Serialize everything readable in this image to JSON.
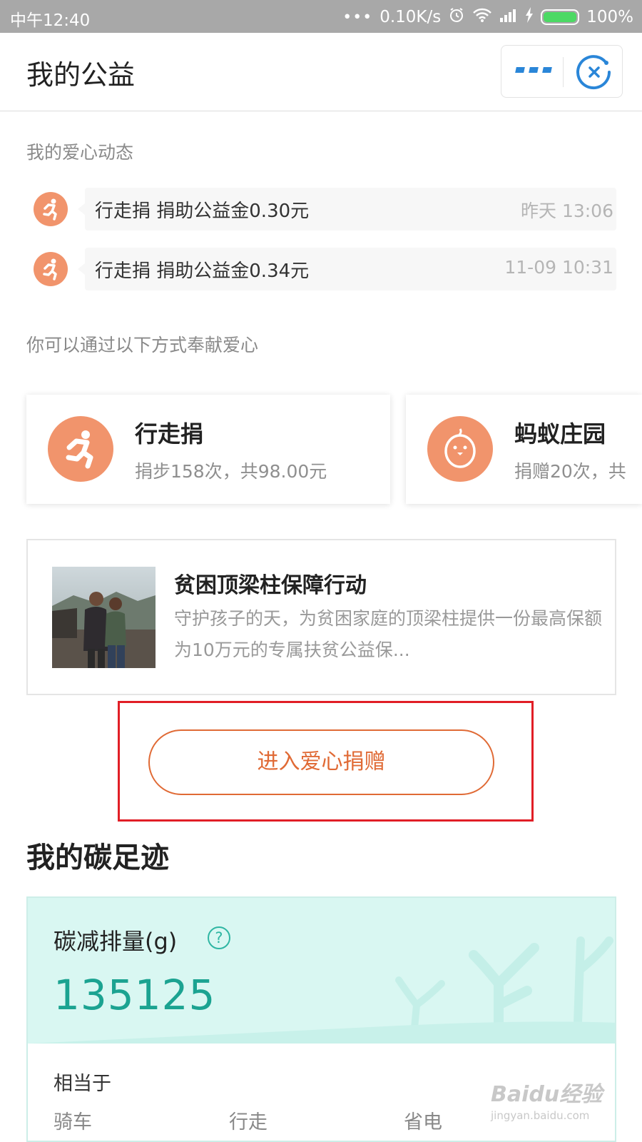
{
  "status_bar": {
    "time": "中午12:40",
    "dots": "•••",
    "network_speed": "0.10K/s",
    "battery": "100%",
    "battery_color": "#4cd964"
  },
  "nav": {
    "title": "我的公益",
    "more_icon": "more-icon",
    "close_icon": "close-icon",
    "accent_color": "#2a86d8"
  },
  "activity": {
    "section_label": "我的爱心动态",
    "items": [
      {
        "text": "行走捐 捐助公益金0.30元",
        "time": "昨天 13:06",
        "icon": "walking-person-icon"
      },
      {
        "text": "行走捐 捐助公益金0.34元",
        "time": "11-09 10:31",
        "icon": "walking-person-icon"
      }
    ]
  },
  "methods": {
    "section_label": "你可以通过以下方式奉献爱心",
    "cards": [
      {
        "title": "行走捐",
        "subtitle": "捐步158次，共98.00元",
        "icon": "running-person-icon"
      },
      {
        "title": "蚂蚁庄园",
        "subtitle": "捐赠20次，共",
        "icon": "chick-icon"
      }
    ],
    "icon_color": "#f1946c"
  },
  "project": {
    "title": "贫困顶梁柱保障行动",
    "description": "守护孩子的天，为贫困家庭的顶梁柱提供一份最高保额为10万元的专属扶贫公益保..."
  },
  "donate_button": {
    "label": "进入爱心捐赠",
    "color": "#e06a35"
  },
  "carbon": {
    "heading": "我的碳足迹",
    "label": "碳减排量(g)",
    "help_icon": "?",
    "value": "135125",
    "value_color": "#1ba391",
    "equivalent_label": "相当于",
    "equivalents": [
      {
        "label": "骑车"
      },
      {
        "label": "行走"
      },
      {
        "label": "省电"
      }
    ]
  },
  "watermark": {
    "logo": "Baidu经验",
    "url": "jingyan.baidu.com"
  }
}
